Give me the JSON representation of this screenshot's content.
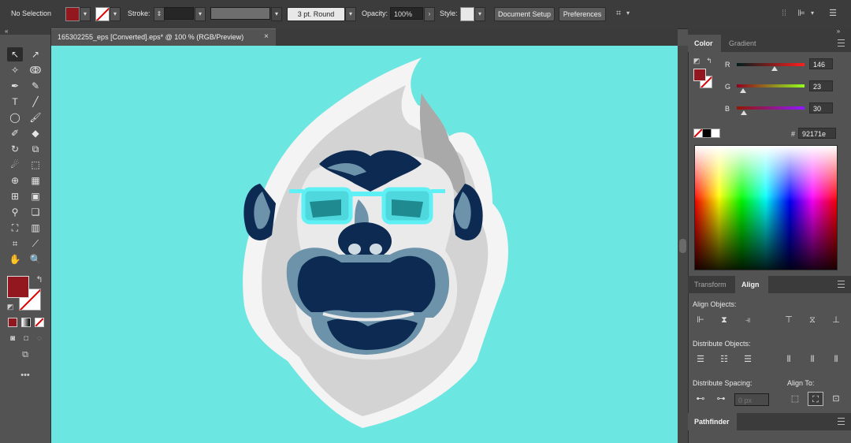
{
  "control_bar": {
    "selection_status": "No Selection",
    "stroke_label": "Stroke:",
    "brush_label": "3 pt. Round",
    "opacity_label": "Opacity:",
    "opacity_value": "100%",
    "style_label": "Style:",
    "document_setup_label": "Document Setup",
    "preferences_label": "Preferences"
  },
  "document": {
    "tab_title": "165302255_eps [Converted].eps* @ 100 % (RGB/Preview)",
    "close_glyph": "×"
  },
  "color_panel": {
    "tabs": [
      "Color",
      "Gradient"
    ],
    "r_label": "R",
    "r_value": "146",
    "g_label": "G",
    "g_value": "23",
    "b_label": "B",
    "b_value": "30",
    "hex_label": "#",
    "hex_value": "92171e",
    "fill_color": "#92171e"
  },
  "align_panel": {
    "tabs": [
      "Transform",
      "Align"
    ],
    "align_objects_label": "Align Objects:",
    "distribute_objects_label": "Distribute Objects:",
    "distribute_spacing_label": "Distribute Spacing:",
    "align_to_label": "Align To:",
    "spacing_placeholder": "0 px"
  },
  "pathfinder_panel": {
    "tab": "Pathfinder"
  },
  "colors": {
    "canvas_bg": "#6ce6e0",
    "accent_fill": "#92171e"
  }
}
